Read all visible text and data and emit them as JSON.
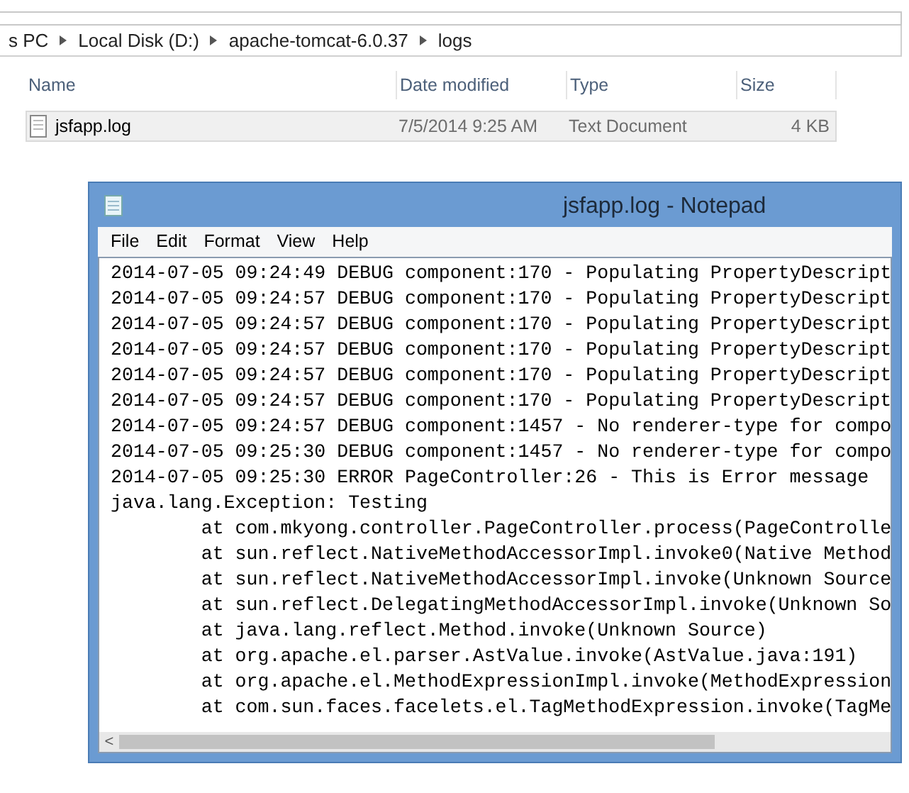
{
  "explorer": {
    "breadcrumb": [
      "s PC",
      "Local Disk (D:)",
      "apache-tomcat-6.0.37",
      "logs"
    ],
    "columns": [
      "Name",
      "Date modified",
      "Type",
      "Size"
    ],
    "files": [
      {
        "name": "jsfapp.log",
        "date_modified": "7/5/2014 9:25 AM",
        "type": "Text Document",
        "size": "4 KB",
        "selected": true
      }
    ]
  },
  "notepad": {
    "title": "jsfapp.log - Notepad",
    "menu": [
      "File",
      "Edit",
      "Format",
      "View",
      "Help"
    ],
    "lines": [
      "2014-07-05 09:24:49 DEBUG component:170 - Populating PropertyDescript",
      "2014-07-05 09:24:57 DEBUG component:170 - Populating PropertyDescript",
      "2014-07-05 09:24:57 DEBUG component:170 - Populating PropertyDescript",
      "2014-07-05 09:24:57 DEBUG component:170 - Populating PropertyDescript",
      "2014-07-05 09:24:57 DEBUG component:170 - Populating PropertyDescript",
      "2014-07-05 09:24:57 DEBUG component:170 - Populating PropertyDescript",
      "2014-07-05 09:24:57 DEBUG component:1457 - No renderer-type for compo",
      "2014-07-05 09:25:30 DEBUG component:1457 - No renderer-type for compo",
      "2014-07-05 09:25:30 ERROR PageController:26 - This is Error message",
      "java.lang.Exception: Testing",
      "\tat com.mkyong.controller.PageController.process(PageControlle",
      "\tat sun.reflect.NativeMethodAccessorImpl.invoke0(Native Method",
      "\tat sun.reflect.NativeMethodAccessorImpl.invoke(Unknown Source",
      "\tat sun.reflect.DelegatingMethodAccessorImpl.invoke(Unknown So",
      "\tat java.lang.reflect.Method.invoke(Unknown Source)",
      "\tat org.apache.el.parser.AstValue.invoke(AstValue.java:191)",
      "\tat org.apache.el.MethodExpressionImpl.invoke(MethodExpression",
      "\tat com.sun.faces.facelets.el.TagMethodExpression.invoke(TagMe"
    ],
    "scroll_left": "<"
  }
}
